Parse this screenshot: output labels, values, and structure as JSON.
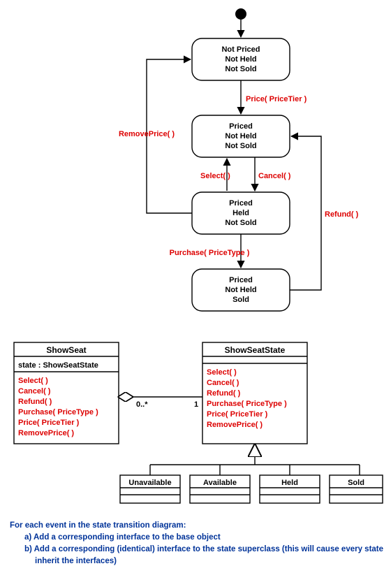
{
  "state_diagram": {
    "states": {
      "s1": {
        "l1": "Not Priced",
        "l2": "Not Held",
        "l3": "Not Sold"
      },
      "s2": {
        "l1": "Priced",
        "l2": "Not Held",
        "l3": "Not Sold"
      },
      "s3": {
        "l1": "Priced",
        "l2": "Held",
        "l3": "Not Sold"
      },
      "s4": {
        "l1": "Priced",
        "l2": "Not Held",
        "l3": "Sold"
      }
    },
    "transitions": {
      "t_price": "Price( PriceTier )",
      "t_select": "Select( )",
      "t_cancel": "Cancel( )",
      "t_purchase": "Purchase( PriceType )",
      "t_remove_price": "RemovePrice( )",
      "t_refund": "Refund( )"
    }
  },
  "class_diagram": {
    "show_seat": {
      "name": "ShowSeat",
      "attr": "state  :  ShowSeatState",
      "ops": {
        "o1": "Select( )",
        "o2": "Cancel( )",
        "o3": "Refund( )",
        "o4": "Purchase( PriceType )",
        "o5": "Price( PriceTier )",
        "o6": "RemovePrice( )"
      }
    },
    "show_seat_state": {
      "name": "ShowSeatState",
      "ops": {
        "o1": "Select( )",
        "o2": "Cancel( )",
        "o3": "Refund( )",
        "o4": "Purchase( PriceType )",
        "o5": "Price( PriceTier )",
        "o6": "RemovePrice( )"
      }
    },
    "subclasses": {
      "c1": "Unavailable",
      "c2": "Available",
      "c3": "Held",
      "c4": "Sold"
    },
    "multiplicities": {
      "left": "0..*",
      "right": "1"
    }
  },
  "notes": {
    "intro": "For each event in the state transition diagram:",
    "a": "a) Add a corresponding interface to the base object",
    "b1": "b) Add a corresponding (identical) interface to the state superclass (this will cause every state subclass to",
    "b2": "inherit the interfaces)"
  },
  "chart_data": {
    "type": "diagram",
    "state_machine": {
      "initial": "NotPriced_NotHeld_NotSold",
      "states": [
        "NotPriced_NotHeld_NotSold",
        "Priced_NotHeld_NotSold",
        "Priced_Held_NotSold",
        "Priced_NotHeld_Sold"
      ],
      "transitions": [
        {
          "from": "initial",
          "to": "NotPriced_NotHeld_NotSold",
          "event": ""
        },
        {
          "from": "NotPriced_NotHeld_NotSold",
          "to": "Priced_NotHeld_NotSold",
          "event": "Price(PriceTier)"
        },
        {
          "from": "Priced_NotHeld_NotSold",
          "to": "Priced_Held_NotSold",
          "event": "Select()"
        },
        {
          "from": "Priced_Held_NotSold",
          "to": "Priced_NotHeld_NotSold",
          "event": "Cancel()"
        },
        {
          "from": "Priced_Held_NotSold",
          "to": "Priced_NotHeld_Sold",
          "event": "Purchase(PriceType)"
        },
        {
          "from": "Priced_NotHeld_Sold",
          "to": "Priced_NotHeld_NotSold",
          "event": "Refund()"
        },
        {
          "from": "Priced_Held_NotSold",
          "to": "NotPriced_NotHeld_NotSold",
          "event": "RemovePrice()"
        }
      ]
    },
    "class_model": {
      "classes": [
        {
          "name": "ShowSeat",
          "attributes": [
            "state : ShowSeatState"
          ],
          "operations": [
            "Select()",
            "Cancel()",
            "Refund()",
            "Purchase(PriceType)",
            "Price(PriceTier)",
            "RemovePrice()"
          ]
        },
        {
          "name": "ShowSeatState",
          "attributes": [],
          "operations": [
            "Select()",
            "Cancel()",
            "Refund()",
            "Purchase(PriceType)",
            "Price(PriceTier)",
            "RemovePrice()"
          ]
        },
        {
          "name": "Unavailable",
          "super": "ShowSeatState"
        },
        {
          "name": "Available",
          "super": "ShowSeatState"
        },
        {
          "name": "Held",
          "super": "ShowSeatState"
        },
        {
          "name": "Sold",
          "super": "ShowSeatState"
        }
      ],
      "associations": [
        {
          "from": "ShowSeat",
          "to": "ShowSeatState",
          "type": "aggregation",
          "from_mult": "0..*",
          "to_mult": "1"
        }
      ]
    }
  }
}
